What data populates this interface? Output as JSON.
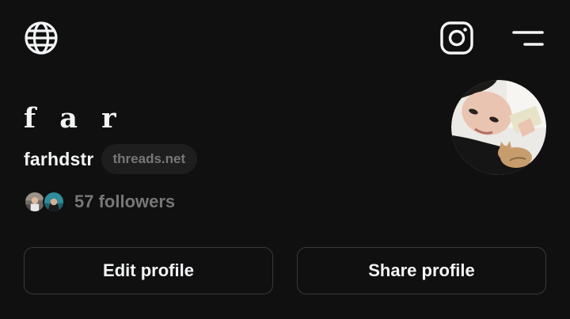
{
  "header": {
    "globe_icon": "globe-icon",
    "instagram_icon": "instagram-icon",
    "menu_icon": "menu-icon"
  },
  "profile": {
    "display_name": "f a r",
    "username": "farhdstr",
    "domain_badge": "threads.net",
    "followers_text": "57 followers"
  },
  "actions": {
    "edit_label": "Edit profile",
    "share_label": "Share profile"
  },
  "colors": {
    "background": "#101010",
    "text_primary": "#f3f5f7",
    "text_secondary": "#777777",
    "button_border": "#3a3a3a",
    "badge_bg": "#1e1e1e"
  }
}
